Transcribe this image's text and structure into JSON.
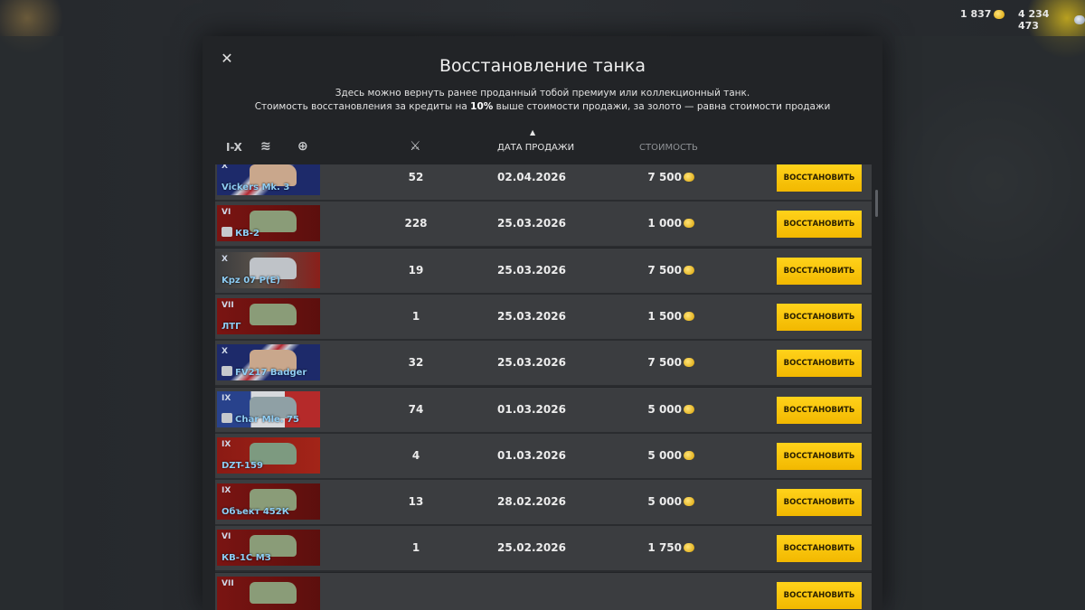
{
  "currency": {
    "gold": "1 837",
    "silver": "4 234 473"
  },
  "modal": {
    "title": "Восстановление танка",
    "desc_line1": "Здесь можно вернуть ранее проданный тобой премиум или коллекционный танк.",
    "desc_line2_a": "Стоимость восстановления за кредиты на ",
    "desc_line2_b": "10%",
    "desc_line2_c": " выше стоимости продажи, за золото — равна стоимости продажи"
  },
  "filters": {
    "tier": "I-X"
  },
  "columns": {
    "date": "ДАТА ПРОДАЖИ",
    "cost": "СТОИМОСТЬ"
  },
  "rows": [
    {
      "tier": "X",
      "name": "Vickers Mk. 3",
      "battles": "52",
      "date": "02.04.2026",
      "cost": "7 500",
      "flag": "uk",
      "premium": false,
      "button": "ВОССТАНОВИТЬ"
    },
    {
      "tier": "VI",
      "name": "КВ-2",
      "battles": "228",
      "date": "25.03.2026",
      "cost": "1 000",
      "flag": "ussr",
      "premium": true,
      "button": "ВОССТАНОВИТЬ"
    },
    {
      "tier": "X",
      "name": "Kpz 07 P(E)",
      "battles": "19",
      "date": "25.03.2026",
      "cost": "7 500",
      "flag": "germany",
      "premium": false,
      "button": "ВОССТАНОВИТЬ"
    },
    {
      "tier": "VII",
      "name": "ЛТГ",
      "battles": "1",
      "date": "25.03.2026",
      "cost": "1 500",
      "flag": "ussr",
      "premium": false,
      "button": "ВОССТАНОВИТЬ"
    },
    {
      "tier": "X",
      "name": "FV217 Badger",
      "battles": "32",
      "date": "25.03.2026",
      "cost": "7 500",
      "flag": "uk",
      "premium": true,
      "button": "ВОССТАНОВИТЬ"
    },
    {
      "tier": "IX",
      "name": "Char Mle. 75",
      "battles": "74",
      "date": "01.03.2026",
      "cost": "5 000",
      "flag": "france",
      "premium": true,
      "button": "ВОССТАНОВИТЬ"
    },
    {
      "tier": "IX",
      "name": "DZT-159",
      "battles": "4",
      "date": "01.03.2026",
      "cost": "5 000",
      "flag": "china",
      "premium": false,
      "button": "ВОССТАНОВИТЬ"
    },
    {
      "tier": "IX",
      "name": "Объект 452К",
      "battles": "13",
      "date": "28.02.2026",
      "cost": "5 000",
      "flag": "ussr",
      "premium": false,
      "button": "ВОССТАНОВИТЬ"
    },
    {
      "tier": "VI",
      "name": "КВ-1С МЗ",
      "battles": "1",
      "date": "25.02.2026",
      "cost": "1 750",
      "flag": "ussr",
      "premium": false,
      "button": "ВОССТАНОВИТЬ"
    },
    {
      "tier": "VII",
      "name": "",
      "battles": "",
      "date": "",
      "cost": "",
      "flag": "ussr",
      "premium": false,
      "button": "ВОССТАНОВИТЬ"
    }
  ]
}
